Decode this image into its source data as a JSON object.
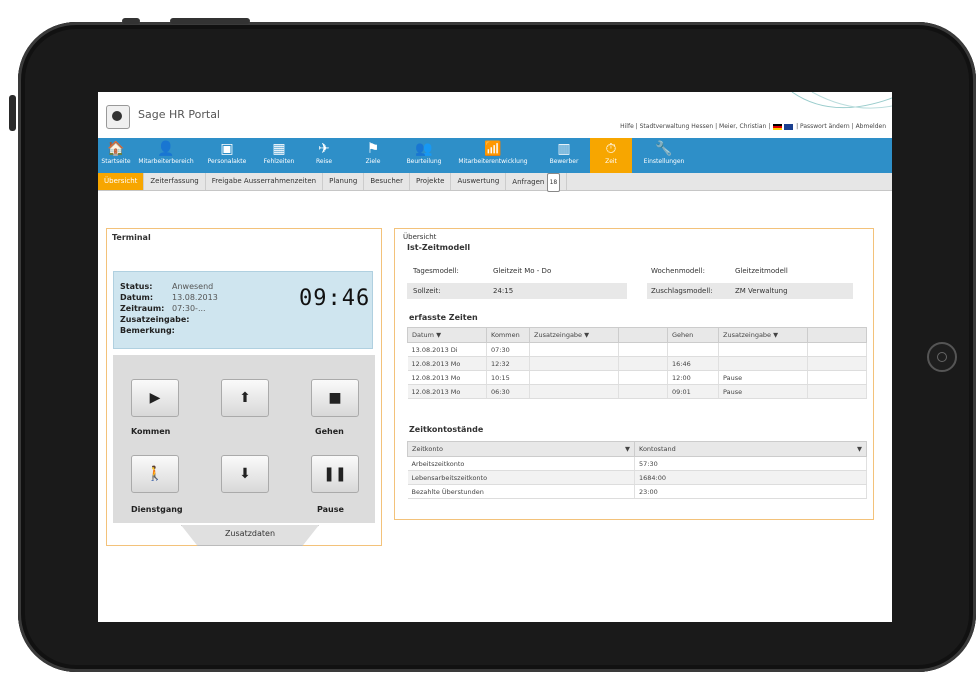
{
  "app": {
    "title": "Sage HR Portal"
  },
  "toplinks": {
    "help": "Hilfe",
    "org": "Stadtverwaltung Hessen",
    "user": "Meier, Christian",
    "change_pw": "Passwort ändern",
    "logout": "Abmelden"
  },
  "nav": [
    {
      "label": "Startseite",
      "icon": "home-icon",
      "glyph": "🏠"
    },
    {
      "label": "Mitarbeiterbereich",
      "icon": "person-icon",
      "glyph": "👤"
    },
    {
      "label": "Personalakte",
      "icon": "file-icon",
      "glyph": "▣"
    },
    {
      "label": "Fehlzeiten",
      "icon": "calendar-icon",
      "glyph": "▦"
    },
    {
      "label": "Reise",
      "icon": "plane-icon",
      "glyph": "✈"
    },
    {
      "label": "Ziele",
      "icon": "flag-icon",
      "glyph": "⚑"
    },
    {
      "label": "Beurteilung",
      "icon": "people-icon",
      "glyph": "👥"
    },
    {
      "label": "Mitarbeiterentwicklung",
      "icon": "chart-icon",
      "glyph": "📶"
    },
    {
      "label": "Bewerber",
      "icon": "building-icon",
      "glyph": "▥"
    },
    {
      "label": "Zeit",
      "icon": "clock-icon",
      "glyph": "⏱"
    },
    {
      "label": "Einstellungen",
      "icon": "wrench-icon",
      "glyph": "🔧"
    }
  ],
  "subnav": [
    "Übersicht",
    "Zeiterfassung",
    "Freigabe Ausserrahmenzeiten",
    "Planung",
    "Besucher",
    "Projekte",
    "Auswertung",
    "Anfragen"
  ],
  "subnav_badge": "18",
  "terminal": {
    "title": "Terminal",
    "status_label": "Status:",
    "status_value": "Anwesend",
    "datum_label": "Datum:",
    "datum_value": "13.08.2013",
    "zeitraum_label": "Zeitraum:",
    "zeitraum_value": "07:30-...",
    "zusatz_label": "Zusatzeingabe:",
    "bemerkung_label": "Bemerkung:",
    "clock": "09:46",
    "buttons": {
      "kommen": "Kommen",
      "gehen": "Gehen",
      "dienstgang": "Dienstgang",
      "pause": "Pause"
    },
    "zusatzdaten": "Zusatzdaten"
  },
  "overview": {
    "title": "Übersicht",
    "ist_title": "Ist-Zeitmodell",
    "tagesmodell_label": "Tagesmodell:",
    "tagesmodell_value": "Gleitzeit Mo - Do",
    "wochenmodell_label": "Wochenmodell:",
    "wochenmodell_value": "Gleitzeitmodell",
    "sollzeit_label": "Sollzeit:",
    "sollzeit_value": "24:15",
    "zuschlag_label": "Zuschlagsmodell:",
    "zuschlag_value": "ZM Verwaltung",
    "erfasst_title": "erfasste Zeiten",
    "erfasst_headers": [
      "Datum",
      "Kommen",
      "Zusatzeingabe",
      "",
      "Gehen",
      "Zusatzeingabe"
    ],
    "erfasst_rows": [
      [
        "13.08.2013 Di",
        "07:30",
        "",
        "",
        "",
        ""
      ],
      [
        "12.08.2013 Mo",
        "12:32",
        "",
        "",
        "16:46",
        ""
      ],
      [
        "12.08.2013 Mo",
        "10:15",
        "",
        "",
        "12:00",
        "Pause"
      ],
      [
        "12.08.2013 Mo",
        "06:30",
        "",
        "",
        "09:01",
        "Pause"
      ]
    ],
    "konten_title": "Zeitkontostände",
    "konten_headers": [
      "Zeitkonto",
      "Kontostand"
    ],
    "konten_rows": [
      [
        "Arbeitszeitkonto",
        "57:30"
      ],
      [
        "Lebensarbeitszeitkonto",
        "1684:00"
      ],
      [
        "Bezahlte Überstunden",
        "23:00"
      ]
    ]
  }
}
